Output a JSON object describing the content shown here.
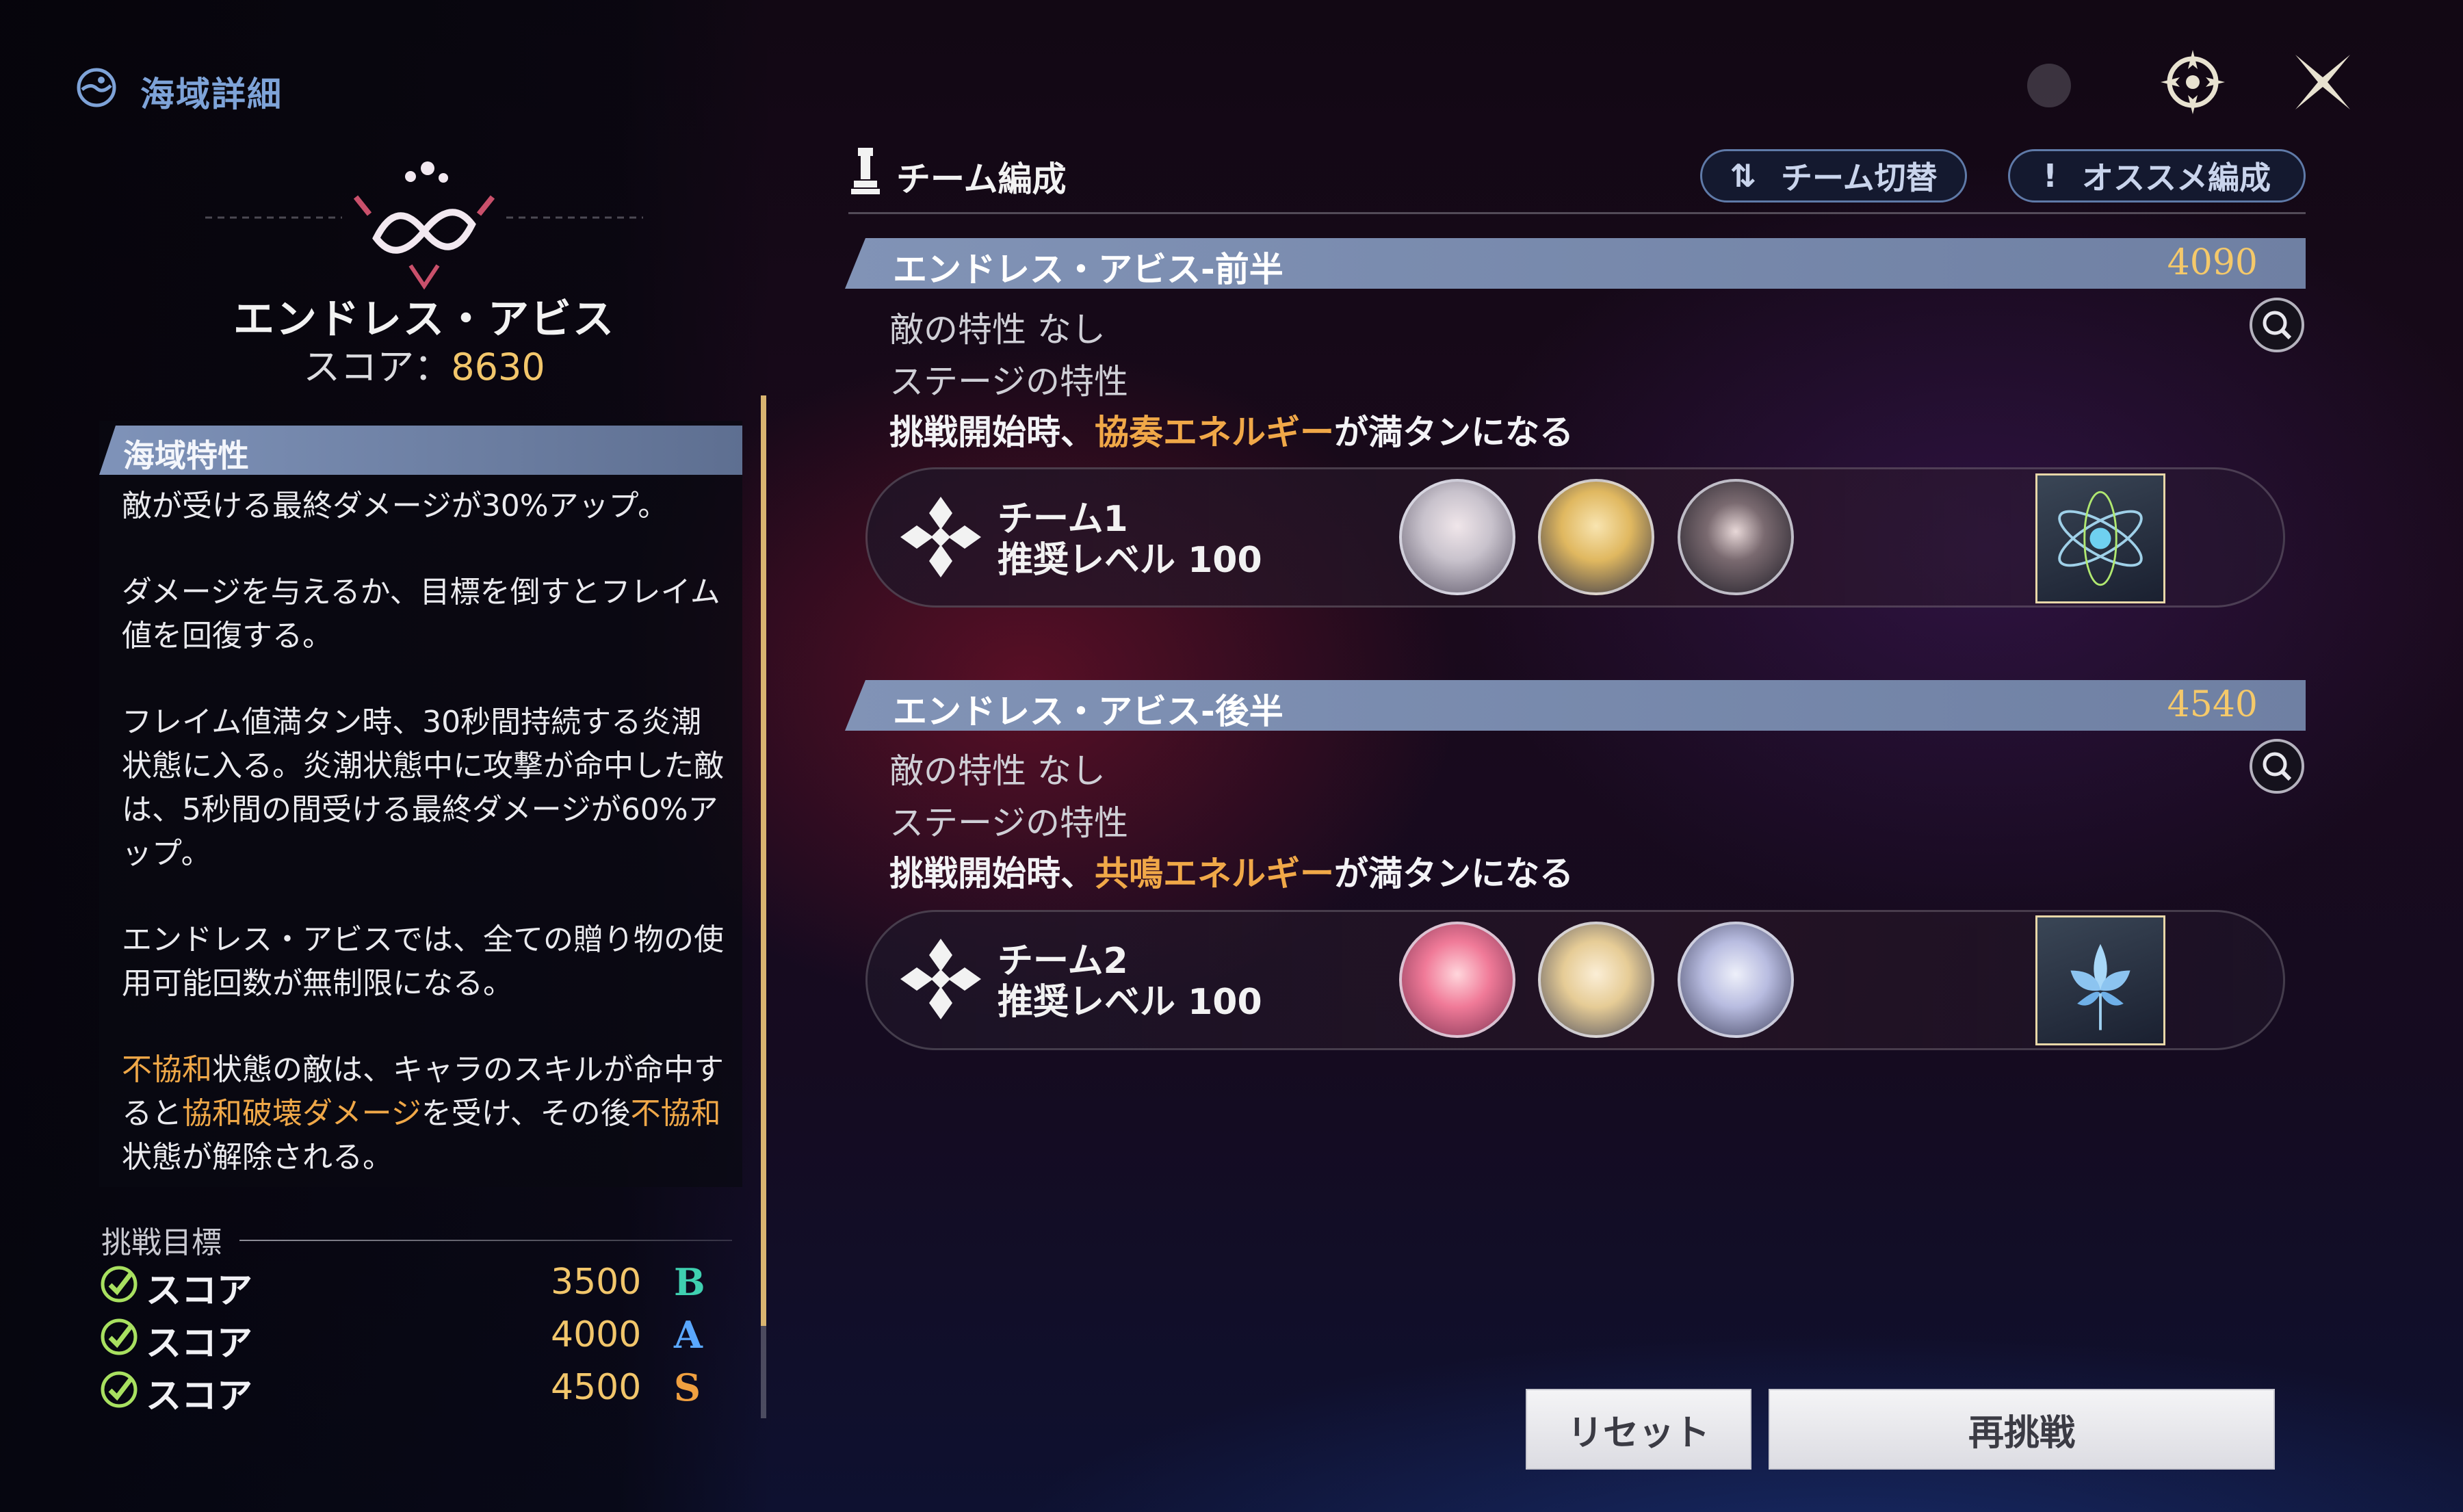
{
  "header": {
    "title": "海域詳細"
  },
  "stage": {
    "name": "エンドレス・アビス",
    "score_label": "スコア：",
    "score_value": "8630"
  },
  "description": {
    "heading": "海域特性",
    "p1": "敵が受ける最終ダメージが30%アップ。",
    "p2": "ダメージを与えるか、目標を倒すとフレイム値を回復する。",
    "p3": "フレイム値満タン時、30秒間持続する炎潮状態に入る。炎潮状態中に攻撃が命中した敵は、5秒間の間受ける最終ダメージが60%アップ。",
    "p4": "エンドレス・アビスでは、全ての贈り物の使用可能回数が無制限になる。",
    "p5_a": "不協和",
    "p5_b": "状態の敵は、キャラのスキルが命中すると",
    "p5_c": "協和破壊ダメージ",
    "p5_d": "を受け、その後",
    "p5_e": "不協和",
    "p5_f": "状態が解除される。"
  },
  "goals": {
    "title": "挑戦目標",
    "rows": [
      {
        "label": "スコア",
        "value": "3500",
        "rank": "B",
        "rank_color": "#3fd0b0"
      },
      {
        "label": "スコア",
        "value": "4000",
        "rank": "A",
        "rank_color": "#5aa8ff"
      },
      {
        "label": "スコア",
        "value": "4500",
        "rank": "S",
        "rank_color": "#f0a040"
      }
    ]
  },
  "team_panel": {
    "title": "チーム編成",
    "switch_label": "チーム切替",
    "recommend_label": "オススメ編成",
    "switch_icon": "⇅",
    "recommend_icon": "!"
  },
  "sections": [
    {
      "title": "エンドレス・アビス-前半",
      "score": "4090",
      "enemy_attr": "敵の特性  なし",
      "stage_attr": "ステージの特性",
      "effect_pre": "挑戦開始時、",
      "effect_hl": "協奏エネルギー",
      "effect_post": "が満タンになる",
      "team_name": "チーム1",
      "team_level": "推奨レベル 100"
    },
    {
      "title": "エンドレス・アビス-後半",
      "score": "4540",
      "enemy_attr": "敵の特性  なし",
      "stage_attr": "ステージの特性",
      "effect_pre": "挑戦開始時、",
      "effect_hl": "共鳴エネルギー",
      "effect_post": "が満タンになる",
      "team_name": "チーム2",
      "team_level": "推奨レベル 100"
    }
  ],
  "buttons": {
    "reset": "リセット",
    "retry": "再挑戦"
  }
}
